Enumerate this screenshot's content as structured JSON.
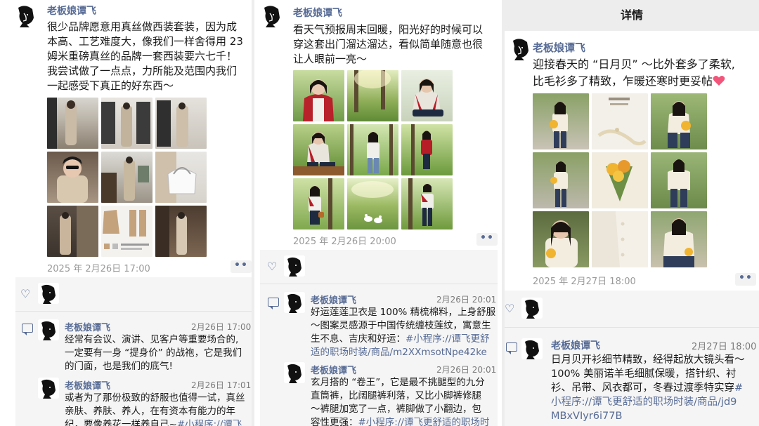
{
  "left_post": {
    "author": "老板娘谭飞",
    "text_lines": [
      "很少品牌愿意用真丝做西装套装，因为成",
      "本高、工艺难度大，像我们一样舍得用 23",
      "姆米重磅真丝的品牌一套西装要六七千！",
      "我尝试做了一点点，力所能及范围内我们",
      "一起感受下真正的好东西～"
    ],
    "timestamp": "2025 年 2月26日 17:00",
    "more": "••",
    "comments": [
      {
        "author": "老板娘谭飞",
        "time": "2月26日 17:00",
        "lines": [
          "经常有会议、演讲、见客户等重要场合的,",
          "一定要有一身 “提身价” 的战袍，它是我们",
          "的门面，也是我们的底气!"
        ]
      },
      {
        "author": "老板娘谭飞",
        "time": "2月26日 17:01",
        "lines": [
          "或者为了那份极致的舒服也值得一试，真丝",
          "亲肤、养肤、养人，在有资本有能力的年",
          "纪，要像养花一样养自己~"
        ],
        "link": "#小程序://谭飞"
      }
    ]
  },
  "middle_post": {
    "author": "老板娘谭飞",
    "text_lines": [
      "看天气预报周末回暖，阳光好的时候可以",
      "穿这套出门溜达溜达，看似简单随意也很",
      "让人眼前一亮～"
    ],
    "timestamp": "2025 年 2月26日 20:00",
    "more": "••",
    "comments": [
      {
        "author": "老板娘谭飞",
        "time": "2月26日 20:01",
        "lines": [
          "好运莲莲卫衣是 100% 精梳棉料，上身舒服",
          "～图案灵感源于中国传统缠枝莲纹，寓意生",
          "生不息、吉庆和好运："
        ],
        "link_lines": [
          "#小程序://谭飞更舒",
          "适的职场时装/商品/m2XXmsotNpe42ke"
        ]
      },
      {
        "author": "老板娘谭飞",
        "time": "2月26日 20:01",
        "lines": [
          "玄月搭的 “卷王”，它是最不挑腿型的九分",
          "直筒裤，比阔腿裤利落，又比小脚裤修腿",
          "～裤腿加宽了一点，裤脚做了小翻边，包",
          "容性更强："
        ],
        "link": "#小程序://谭飞更舒适的职场时"
      }
    ]
  },
  "right_post": {
    "nav_title": "详情",
    "author": "老板娘谭飞",
    "text_lines": [
      "迎接春天的 “日月贝” ～比外套多了柔软,",
      "比毛衫多了精致，乍暖还寒时更妥帖"
    ],
    "timestamp": "2025 年 2月27日 18:00",
    "more": "••",
    "comments": [
      {
        "author": "老板娘谭飞",
        "time": "2月27日 18:00",
        "lines": [
          "日月贝开衫细节精致，经得起放大镜头看～",
          "100% 美丽诺羊毛细腻保暖，搭针织、衬",
          "衫、吊带、风衣都可，冬春过渡季特实穿"
        ],
        "link_lines": [
          "#",
          "小程序://谭飞更舒适的职场时装/商品/jd9",
          "MBxVIyr6i77B"
        ]
      }
    ]
  },
  "colors": {
    "link": "#576b95",
    "bg": "#ffffff",
    "bar": "#f5f5f5",
    "timestamp": "#9a9a9a"
  },
  "icons": {
    "like": "heart-outline-icon",
    "comment": "comment-bubble-icon",
    "more": "more-dots-icon"
  }
}
